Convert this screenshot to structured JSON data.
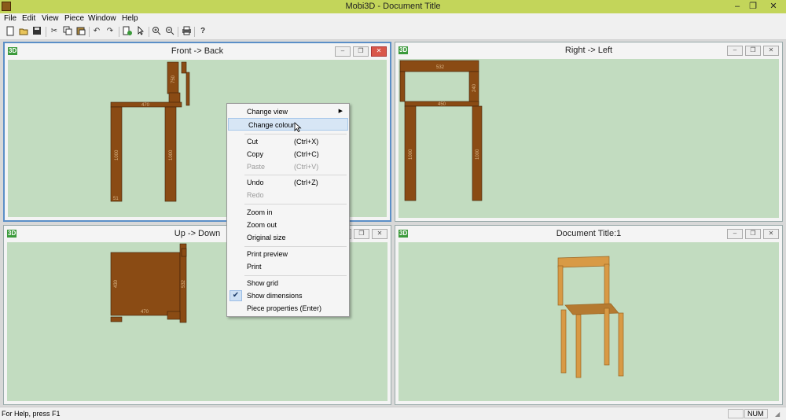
{
  "window": {
    "title": "Mobi3D - Document Title",
    "minimize": "–",
    "restore": "❐",
    "close": "✕"
  },
  "menubar": [
    "File",
    "Edit",
    "View",
    "Piece",
    "Window",
    "Help"
  ],
  "toolbar": {
    "icons": [
      "new-icon",
      "open-icon",
      "save-icon",
      "cut-icon",
      "copy-icon",
      "paste-icon",
      "undo-icon",
      "redo-icon",
      "add-piece-icon",
      "select-pointer-icon",
      "zoom-in-icon",
      "zoom-out-icon",
      "print-icon",
      "help-icon"
    ]
  },
  "views": {
    "front": {
      "title": "Front -> Back",
      "badge": "3D"
    },
    "right": {
      "title": "Right -> Left",
      "badge": "3D"
    },
    "up": {
      "title": "Up -> Down",
      "badge": "3D"
    },
    "doc": {
      "title": "Document Title:1",
      "badge": "3D"
    }
  },
  "view_buttons": {
    "minimize": "–",
    "restore": "❐",
    "close": "✕"
  },
  "dimensions": {
    "front": {
      "seat": "470",
      "leg_left": "1000",
      "leg_right": "1000",
      "back": "750",
      "foot": "51"
    },
    "right": {
      "top": "532",
      "seat": "450",
      "leg_left": "1000",
      "leg_right": "1000",
      "back": "240"
    },
    "up": {
      "side": "430",
      "bottom": "470",
      "right": "532"
    }
  },
  "context_menu": {
    "change_view": "Change view",
    "change_colour": "Change colour",
    "cut": "Cut",
    "cut_sc": "(Ctrl+X)",
    "copy": "Copy",
    "copy_sc": "(Ctrl+C)",
    "paste": "Paste",
    "paste_sc": "(Ctrl+V)",
    "undo": "Undo",
    "undo_sc": "(Ctrl+Z)",
    "redo": "Redo",
    "zoom_in": "Zoom in",
    "zoom_out": "Zoom out",
    "original_size": "Original size",
    "print_preview": "Print preview",
    "print": "Print",
    "show_grid": "Show grid",
    "show_dimensions": "Show dimensions",
    "piece_properties": "Piece properties  (Enter)"
  },
  "statusbar": {
    "help": "For Help, press F1",
    "num": "NUM"
  },
  "colors": {
    "titlebar": "#c3d55a",
    "canvas": "#c2dcc0",
    "wood": "#8a4b14",
    "render_wood": "#d89a45"
  }
}
